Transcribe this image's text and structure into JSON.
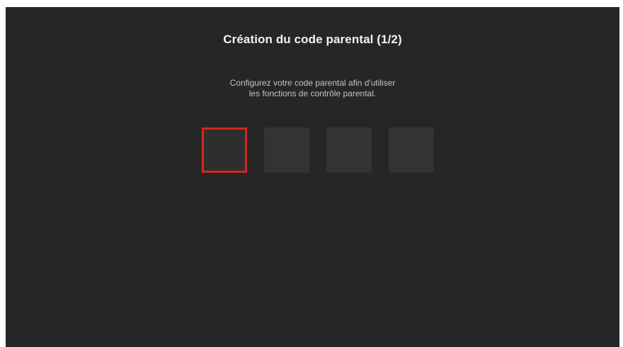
{
  "dialog": {
    "title": "Création du code parental (1/2)",
    "description_line1": "Configurez votre code parental afin d'utiliser",
    "description_line2": "les fonctions de contrôle parental."
  },
  "pin": {
    "digits": 4,
    "focused_index": 0,
    "focus_color": "#d6261f"
  },
  "colors": {
    "background": "#262626",
    "box": "#333333"
  }
}
